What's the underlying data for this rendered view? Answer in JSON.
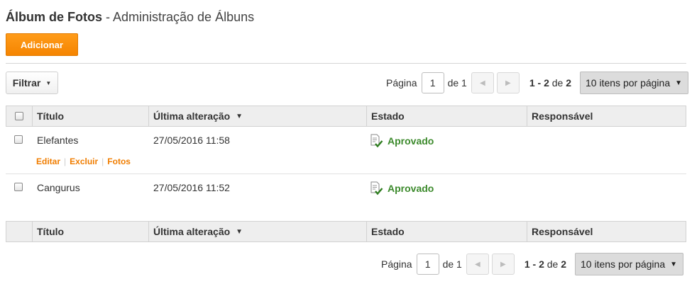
{
  "header": {
    "title_bold": "Álbum de Fotos",
    "title_rest": " - Administração de Álbuns"
  },
  "toolbar": {
    "add_label": "Adicionar",
    "filter_label": "Filtrar"
  },
  "pager": {
    "page_label": "Página",
    "current_page": "1",
    "of_label": "de 1",
    "range_start": "1 - 2",
    "range_of": " de ",
    "range_total": "2",
    "per_page": "10 itens por página"
  },
  "table": {
    "columns": [
      "Título",
      "Última alteração",
      "Estado",
      "Responsável"
    ],
    "rows": [
      {
        "title": "Elefantes",
        "modified": "27/05/2016 11:58",
        "state": "Aprovado",
        "owner": ""
      },
      {
        "title": "Cangurus",
        "modified": "27/05/2016 11:52",
        "state": "Aprovado",
        "owner": ""
      }
    ],
    "row_actions": [
      "Editar",
      "Excluir",
      "Fotos"
    ]
  },
  "colors": {
    "accent": "#f58400",
    "link": "#f07d00",
    "approved": "#3c8a2c"
  },
  "icons": [
    "caret-down-icon",
    "chevron-left-icon",
    "chevron-right-icon",
    "approved-document-icon",
    "sort-desc-icon"
  ]
}
